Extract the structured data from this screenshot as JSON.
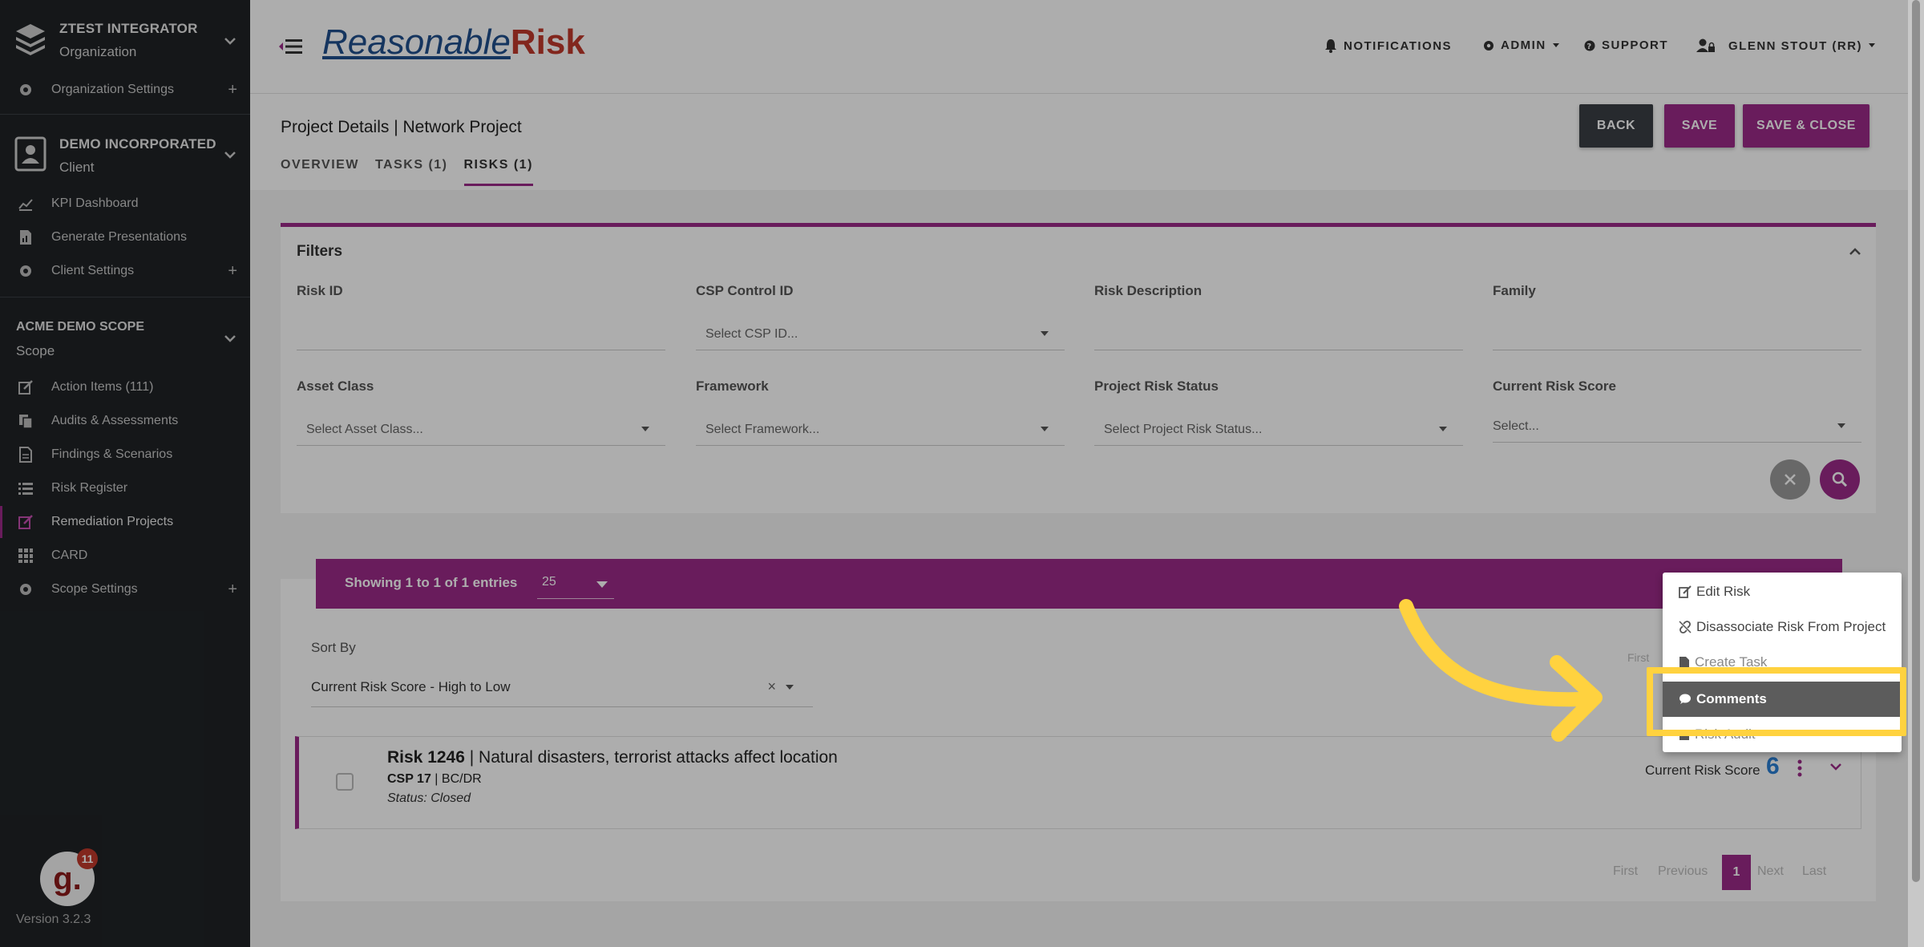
{
  "sidebar": {
    "org": {
      "title": "ZTEST INTEGRATOR",
      "subtitle": "Organization"
    },
    "org_settings": "Organization Settings",
    "client": {
      "title": "DEMO INCORPORATED",
      "subtitle": "Client"
    },
    "client_items": [
      "KPI Dashboard",
      "Generate Presentations",
      "Client Settings"
    ],
    "scope": {
      "title": "ACME DEMO SCOPE",
      "subtitle": "Scope"
    },
    "scope_items": [
      "Action Items (111)",
      "Audits & Assessments",
      "Findings & Scenarios",
      "Risk Register",
      "Remediation Projects",
      "CARD",
      "Scope Settings"
    ],
    "badge_count": "11",
    "logo_letter": "g.",
    "version": "Version 3.2.3"
  },
  "topbar": {
    "brand_part1": "Reasonable",
    "brand_part2": "Risk",
    "notifications": "NOTIFICATIONS",
    "admin": "ADMIN",
    "support": "SUPPORT",
    "user": "GLENN STOUT (RR)"
  },
  "project": {
    "title": "Project Details | Network Project",
    "tabs": [
      "OVERVIEW",
      "TASKS (1)",
      "RISKS (1)"
    ],
    "buttons": {
      "back": "BACK",
      "save": "SAVE",
      "save_close": "SAVE & CLOSE"
    }
  },
  "filters": {
    "title": "Filters",
    "risk_id": "Risk ID",
    "csp_control_id": "CSP Control ID",
    "csp_placeholder": "Select CSP ID...",
    "risk_description": "Risk Description",
    "family": "Family",
    "asset_class": "Asset Class",
    "asset_placeholder": "Select Asset Class...",
    "framework": "Framework",
    "framework_placeholder": "Select Framework...",
    "project_risk_status": "Project Risk Status",
    "status_placeholder": "Select Project Risk Status...",
    "current_risk_score": "Current Risk Score",
    "score_placeholder": "Select..."
  },
  "results": {
    "showing": "Showing 1 to 1 of 1 entries",
    "per_page": "25",
    "sort_by": "Sort By",
    "sort_value": "Current Risk Score - High to Low",
    "first_small": "First",
    "risk": {
      "id": "Risk 1246",
      "desc": "Natural disasters, terrorist attacks affect location",
      "csp": "CSP 17",
      "family": "BC/DR",
      "status": "Status: Closed",
      "score_label": "Current Risk Score",
      "score": "6"
    },
    "pager": {
      "first": "First",
      "previous": "Previous",
      "page": "1",
      "next": "Next",
      "last": "Last"
    }
  },
  "context_menu": {
    "edit": "Edit Risk",
    "disassociate": "Disassociate Risk From Project",
    "create_task": "Create Task",
    "comments": "Comments",
    "risk_audit": "Risk Audit"
  },
  "colors": {
    "accent": "#9b2a88",
    "highlight": "#ffd23f",
    "sidebar": "#1f2326"
  }
}
